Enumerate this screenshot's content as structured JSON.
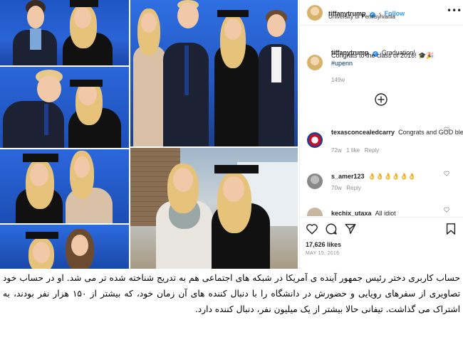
{
  "post": {
    "author": "tiffanytrump",
    "follow_label": "Follow",
    "location": "University of Pennsylvania",
    "more_icon": "more-horizontal-icon",
    "caption_line1": "Graduation!",
    "caption_line2": "Congrats to the class of 2016! 🎓🎉",
    "hashtag": "#upenn",
    "caption_age": "149w",
    "likes": "17,626 likes",
    "date": "MAY 15, 2016",
    "verified_mark": "✓"
  },
  "comments": [
    {
      "user": "texasconcealedcarry",
      "text": "Congrats and GOD bless !",
      "age": "72w",
      "likes": "1 like",
      "reply": "Reply"
    },
    {
      "user": "s_amer123",
      "text": "👌👌👌👌👌👌",
      "age": "70w",
      "likes": "",
      "reply": "Reply"
    },
    {
      "user": "kechix_utaxa",
      "text": "All idiot",
      "age": "",
      "likes": "",
      "reply": ""
    }
  ],
  "caption_fa": "حساب کاربری دختر رئیس جمهور آینده ی آمریکا در شبکه های اجتماعی هم به تدریج شناخته شده تر می شد. او در حساب خود تصاویری از سفرهای رویایی و حضورش در دانشگاه را با دنبال کننده های آن زمان خود، که بیشتر از ۱۵۰ هزار نفر بودند، به اشتراک می گذاشت. تیفانی حالا بیشتر از یک میلیون نفر، دنبال کننده دارد.",
  "colors": {
    "link_blue": "#3897f0",
    "text": "#262626",
    "muted": "#8e8e8e"
  }
}
